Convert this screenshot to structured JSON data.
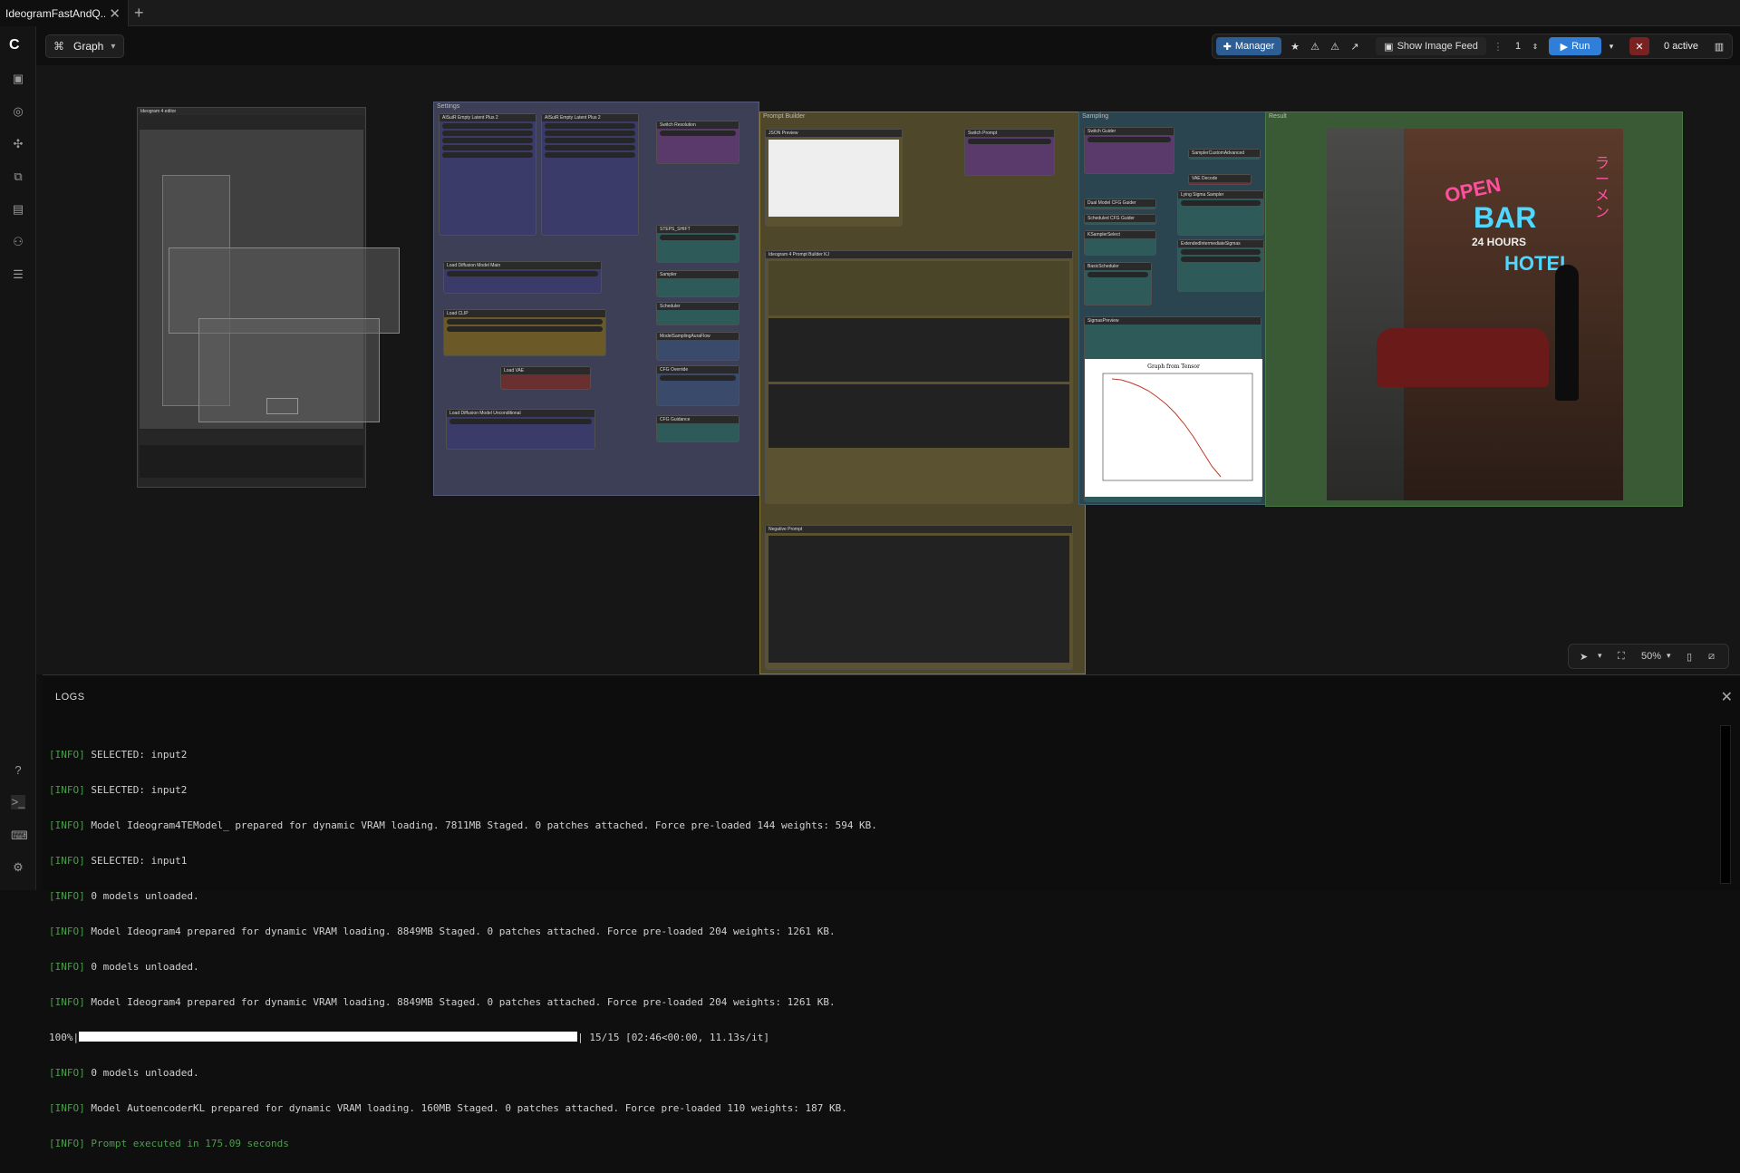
{
  "tabs": [
    {
      "label": "IdeogramFastAndQ..."
    }
  ],
  "graph_menu": {
    "label": "Graph"
  },
  "toolbar": {
    "manager_label": "Manager",
    "show_feed_label": "Show Image Feed",
    "queue_count": "1",
    "run_label": "Run",
    "active_label": "0 active"
  },
  "canvas": {
    "groups": [
      {
        "title": "Settings"
      },
      {
        "title": "Prompt Builder"
      },
      {
        "title": "Sampling"
      },
      {
        "title": "Result"
      }
    ],
    "nodes": [
      {
        "title": "Ideogram 4 editor"
      },
      {
        "title": "AISuiR Empty Latent Plus 2"
      },
      {
        "title": "AISuiR Empty Latent Plus 2"
      },
      {
        "title": "Switch Resolution"
      },
      {
        "title": "Load Diffusion Model Main"
      },
      {
        "title": "Load CLIP"
      },
      {
        "title": "Load VAE"
      },
      {
        "title": "Load Diffusion Model Unconditional"
      },
      {
        "title": "STEPS_SHIFT"
      },
      {
        "title": "Sampler"
      },
      {
        "title": "Scheduler"
      },
      {
        "title": "ModelSamplingAuraFlow"
      },
      {
        "title": "CFG Override"
      },
      {
        "title": "CFG Guidance"
      },
      {
        "title": "JSON Preview"
      },
      {
        "title": "Ideogram 4 Prompt Builder KJ"
      },
      {
        "title": "Switch Prompt"
      },
      {
        "title": "Negative Prompt"
      },
      {
        "title": "Switch Guider"
      },
      {
        "title": "Dual Model CFG Guider"
      },
      {
        "title": "Scheduled CFG Guider"
      },
      {
        "title": "KSamplerSelect"
      },
      {
        "title": "BasicScheduler"
      },
      {
        "title": "SigmasPreview"
      },
      {
        "title": "Lying Sigma Sampler"
      },
      {
        "title": "ExtendedIntermediateSigmas"
      },
      {
        "title": "VAE Decode"
      },
      {
        "title": "SamplerCustomAdvanced"
      }
    ],
    "sigma_chart_title": "Graph from Tensor",
    "neon_sign": {
      "line1": "OPEN",
      "line2": "BAR",
      "line3": "24 HOURS",
      "line4": "HOTEL",
      "kanji": "ラーメン"
    }
  },
  "zoom": {
    "level": "50%"
  },
  "logs": {
    "title": "LOGS",
    "lines": [
      {
        "level": "[INFO]",
        "text": " SELECTED: input2"
      },
      {
        "level": "[INFO]",
        "text": " SELECTED: input2"
      },
      {
        "level": "[INFO]",
        "text": " Model Ideogram4TEModel_ prepared for dynamic VRAM loading. 7811MB Staged. 0 patches attached. Force pre-loaded 144 weights: 594 KB."
      },
      {
        "level": "[INFO]",
        "text": " SELECTED: input1"
      },
      {
        "level": "[INFO]",
        "text": " 0 models unloaded."
      },
      {
        "level": "[INFO]",
        "text": " Model Ideogram4 prepared for dynamic VRAM loading. 8849MB Staged. 0 patches attached. Force pre-loaded 204 weights: 1261 KB."
      },
      {
        "level": "[INFO]",
        "text": " 0 models unloaded."
      },
      {
        "level": "[INFO]",
        "text": " Model Ideogram4 prepared for dynamic VRAM loading. 8849MB Staged. 0 patches attached. Force pre-loaded 204 weights: 1261 KB."
      }
    ],
    "progress": {
      "prefix": "100%|",
      "suffix": "| 15/15 [02:46<00:00, 11.13s/it]"
    },
    "lines_after": [
      {
        "level": "[INFO]",
        "text": " 0 models unloaded."
      },
      {
        "level": "[INFO]",
        "text": " Model AutoencoderKL prepared for dynamic VRAM loading. 160MB Staged. 0 patches attached. Force pre-loaded 110 weights: 187 KB."
      }
    ],
    "final": {
      "level": "[INFO]",
      "text": " Prompt executed in 175.09 seconds"
    }
  }
}
